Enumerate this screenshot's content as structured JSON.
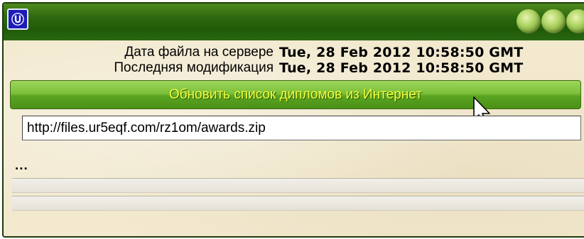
{
  "window": {
    "icon_glyph": "Ⓤ",
    "icon_name": "app-icon",
    "title_buttons": [
      "minimize",
      "maximize",
      "close"
    ],
    "accent_color": "#2f6a10"
  },
  "info": {
    "server_date_label": "Дата файла на сервере",
    "server_date_value": "Tue, 28 Feb 2012 10:58:50 GMT",
    "last_mod_label": "Последняя модификация",
    "last_mod_value": "Tue, 28 Feb 2012 10:58:50 GMT"
  },
  "update_button": {
    "label": "Обновить список дипломов из Интернет",
    "text_color": "#f5ff3a"
  },
  "url_field": {
    "value": "http://files.ur5eqf.com/rz1om/awards.zip"
  },
  "status": {
    "message": "...",
    "footer_dots": "...",
    "progress1": 0,
    "progress2": 0
  }
}
